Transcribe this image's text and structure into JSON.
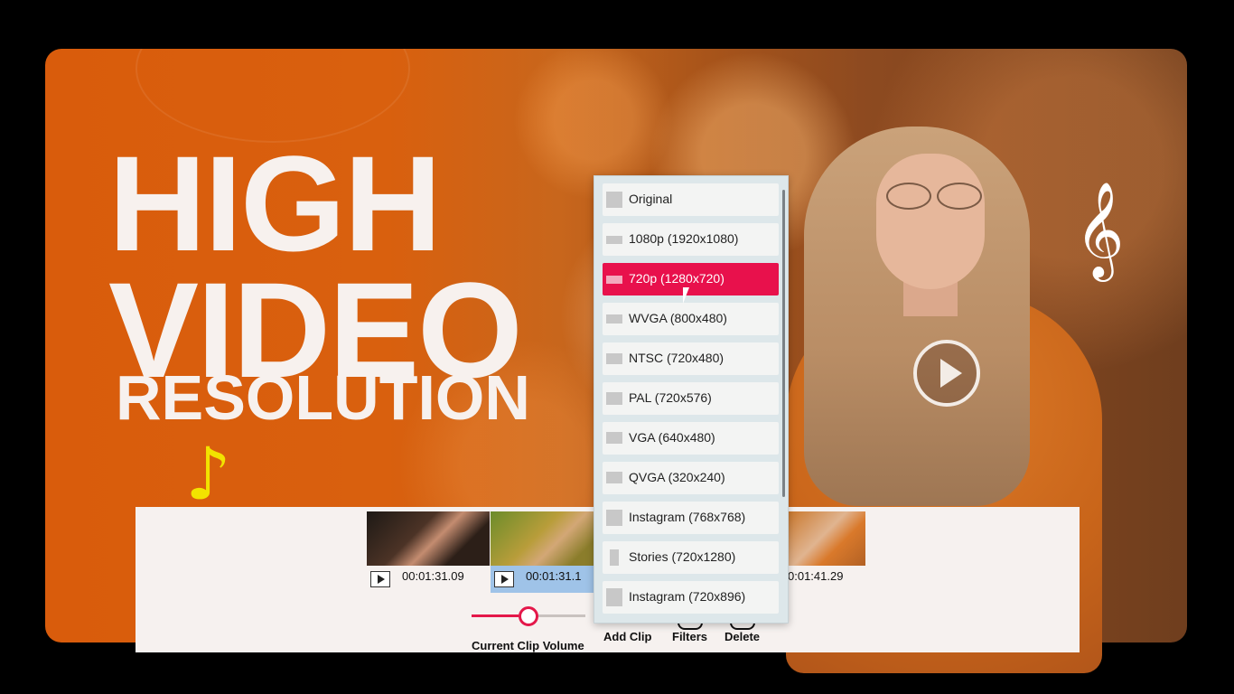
{
  "headline": {
    "line1": "HIGH",
    "line2": "VIDEO",
    "line3": "RESOLUTION"
  },
  "decor": {
    "note_icon": "music-note-icon",
    "clef_icon": "treble-clef-icon",
    "note_glyph": "♪",
    "clef_glyph": "𝄞"
  },
  "resolution_menu": {
    "selected_index": 2,
    "options": [
      {
        "label": "Original"
      },
      {
        "label": "1080p (1920x1080)"
      },
      {
        "label": "720p (1280x720)"
      },
      {
        "label": "WVGA (800x480)"
      },
      {
        "label": "NTSC (720x480)"
      },
      {
        "label": "PAL (720x576)"
      },
      {
        "label": "VGA (640x480)"
      },
      {
        "label": "QVGA (320x240)"
      },
      {
        "label": "Instagram (768x768)"
      },
      {
        "label": "Stories (720x1280)"
      },
      {
        "label": "Instagram (720x896)"
      }
    ]
  },
  "timeline": {
    "clips": [
      {
        "time": "00:01:31.09",
        "selected": false
      },
      {
        "time": "00:01:31.1",
        "selected": true
      },
      {
        "time": "0:01:41.29",
        "selected": false
      }
    ]
  },
  "volume": {
    "label": "Current Clip Volume",
    "level_percent": 50
  },
  "toolbar": {
    "add_clip": "Add Clip",
    "filters": "Filters",
    "delete": "Delete"
  },
  "colors": {
    "accent": "#e8114c",
    "orange": "#d95c0c",
    "panel": "#f6f1ef"
  }
}
